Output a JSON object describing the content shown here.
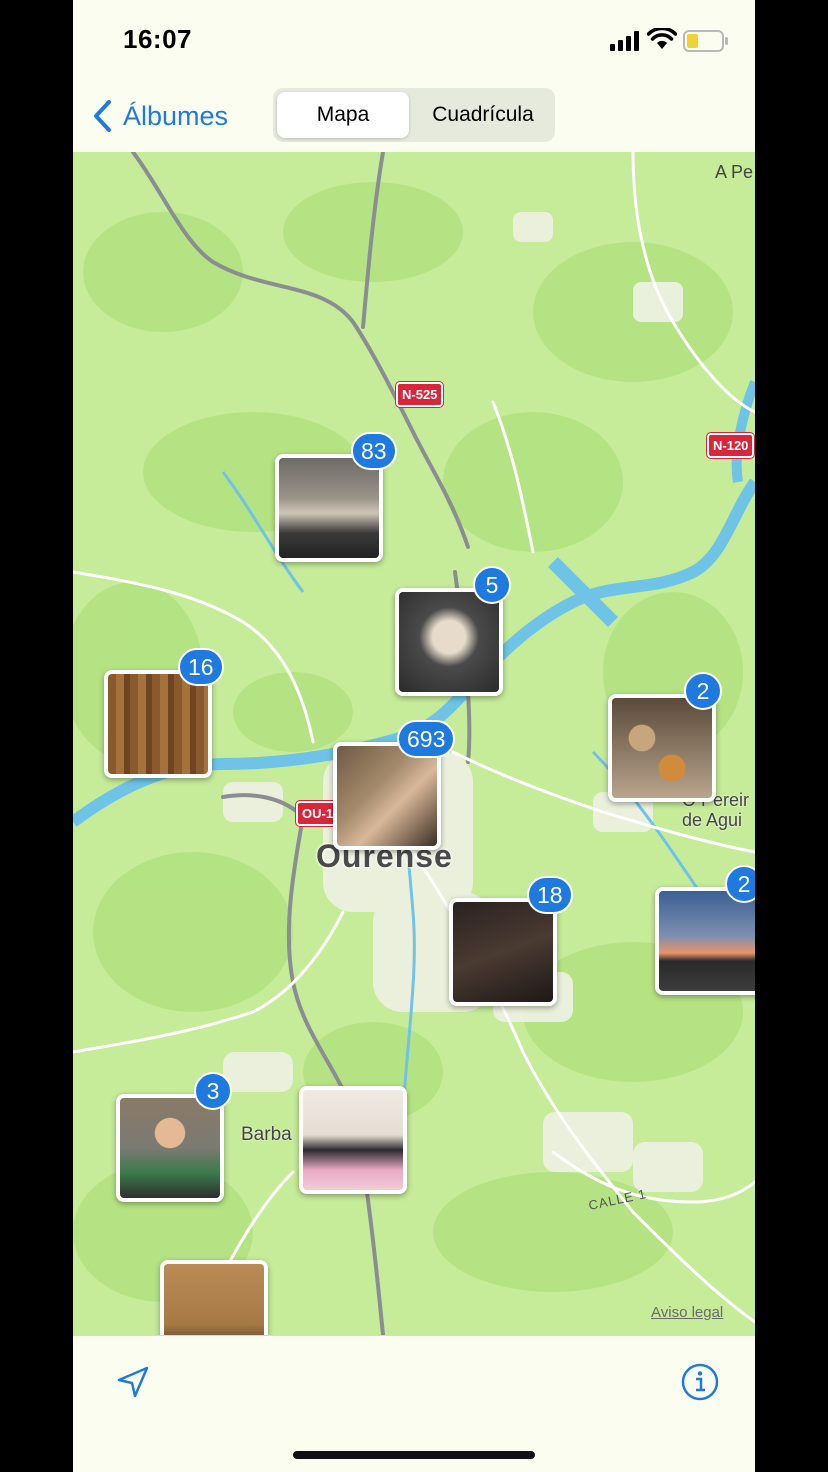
{
  "status_bar": {
    "time": "16:07"
  },
  "nav": {
    "back_label": "Álbumes",
    "segments": [
      "Mapa",
      "Cuadrícula"
    ],
    "selected_segment": "Mapa"
  },
  "map": {
    "labels": {
      "city": "Ourense",
      "town_barba": "Barba",
      "top_right": "A Pe",
      "pereira_line1": "O Pereir",
      "pereira_line2": "de Agui",
      "street": "CALLE 1"
    },
    "road_signs": {
      "n525": "N-525",
      "n120": "N-120",
      "ou": "OU-11"
    },
    "legal": "Aviso legal",
    "photo_clusters": [
      {
        "count": "83",
        "subject": "cats on tiled floor"
      },
      {
        "count": "5",
        "subject": "two cats eating"
      },
      {
        "count": "16",
        "subject": "wooden wall"
      },
      {
        "count": "2",
        "subject": "food on table"
      },
      {
        "count": "693",
        "subject": "indoor room"
      },
      {
        "count": "18",
        "subject": "people in dark room"
      },
      {
        "count": "2",
        "subject": "sunset sky"
      },
      {
        "count": "3",
        "subject": "smiling child"
      },
      {
        "count": "",
        "subject": "bed with clothes"
      },
      {
        "count": "",
        "subject": "cat on ground"
      }
    ]
  },
  "toolbar": {
    "location_icon": "location-arrow-icon",
    "info_icon": "info-circle-icon"
  },
  "colors": {
    "accent": "#1f7ae0",
    "map_green": "#c6ec9a",
    "river": "#6ec3e6",
    "road_red": "#d9263b"
  }
}
